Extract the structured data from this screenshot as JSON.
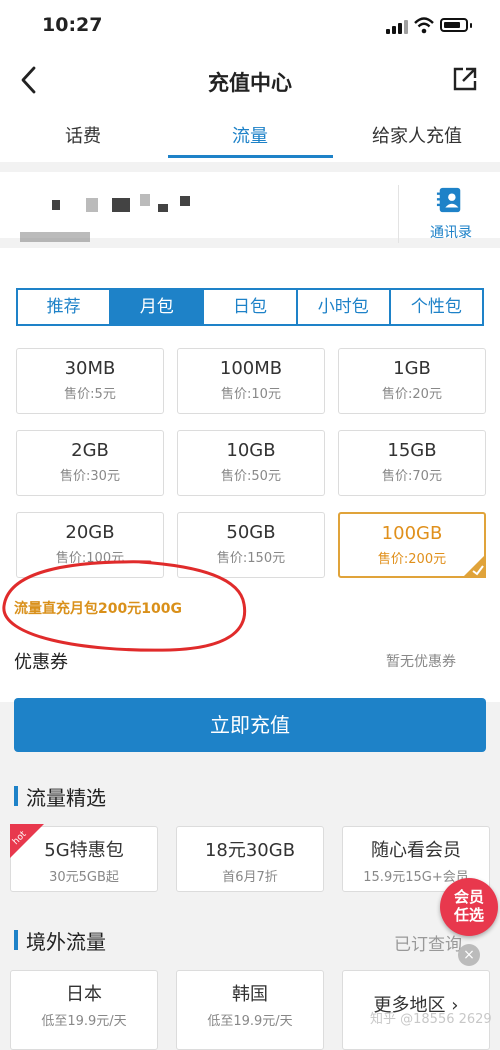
{
  "status_bar": {
    "time": "10:27"
  },
  "nav": {
    "title": "充值中心"
  },
  "tabs": [
    "话费",
    "流量",
    "给家人充值"
  ],
  "contacts": {
    "label": "通讯录"
  },
  "segments": [
    "推荐",
    "月包",
    "日包",
    "小时包",
    "个性包"
  ],
  "packages": [
    {
      "size": "30MB",
      "price": "售价:5元"
    },
    {
      "size": "100MB",
      "price": "售价:10元"
    },
    {
      "size": "1GB",
      "price": "售价:20元"
    },
    {
      "size": "2GB",
      "price": "售价:30元"
    },
    {
      "size": "10GB",
      "price": "售价:50元"
    },
    {
      "size": "15GB",
      "price": "售价:70元"
    },
    {
      "size": "20GB",
      "price": "售价:100元"
    },
    {
      "size": "50GB",
      "price": "售价:150元"
    },
    {
      "size": "100GB",
      "price": "售价:200元"
    }
  ],
  "promo_text": "流量直充月包200元100G",
  "coupon": {
    "label": "优惠券",
    "value": "暂无优惠券"
  },
  "cta_label": "立即充值",
  "featured": {
    "title": "流量精选",
    "hot_badge": "hot",
    "items": [
      {
        "title": "5G特惠包",
        "sub": "30元5GB起"
      },
      {
        "title": "18元30GB",
        "sub": "首6月7折"
      },
      {
        "title": "随心看会员",
        "sub": "15.9元15G+会员"
      }
    ]
  },
  "overseas": {
    "title": "境外流量",
    "ordered_link": "已订查询",
    "items": [
      {
        "title": "日本",
        "sub": "低至19.9元/天"
      },
      {
        "title": "韩国",
        "sub": "低至19.9元/天"
      },
      {
        "title": "更多地区 ›",
        "sub": ""
      }
    ]
  },
  "vip_badge": {
    "line1": "会员",
    "line2": "任选",
    "close": "×"
  },
  "watermark": "知乎 @18556 2629",
  "colors": {
    "accent": "#1e82c8",
    "selected": "#e0a33a",
    "promo": "#d9901a",
    "vip": "#e8384d"
  }
}
